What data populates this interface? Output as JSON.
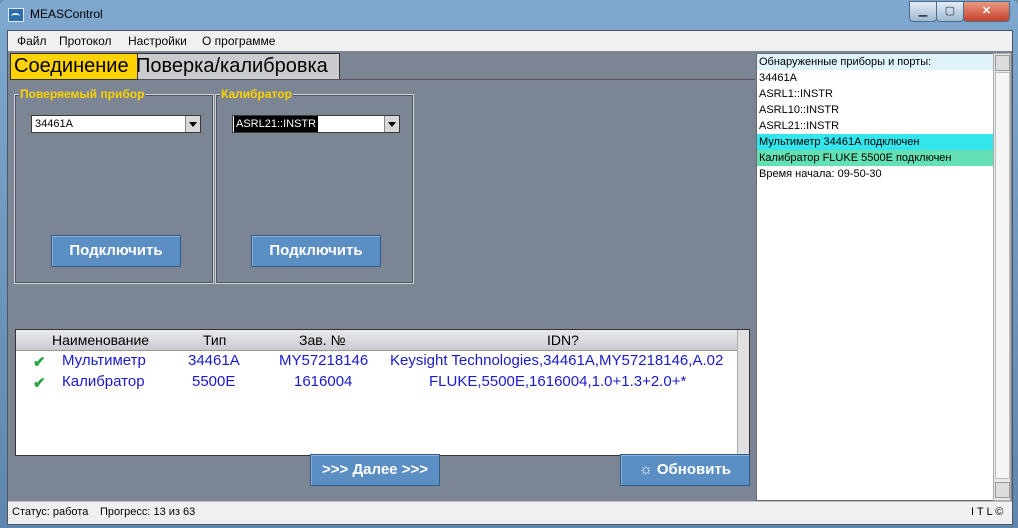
{
  "window": {
    "title": "MEASControl",
    "minimize": "▁",
    "maximize": "▢",
    "close": "✕"
  },
  "menu": [
    "Файл",
    "Протокол",
    "Настройки",
    "О программе"
  ],
  "tabs": {
    "active": "Соединение",
    "inactive": "Поверка/калибровка"
  },
  "device_group": {
    "title": "Поверяемый прибор",
    "selected": "34461A",
    "connect_label": "Подключить"
  },
  "calibrator_group": {
    "title": "Калибратор",
    "selected": "ASRL21::INSTR",
    "connect_label": "Подключить"
  },
  "table": {
    "headers": [
      "Наименование",
      "Тип",
      "Зав. №",
      "IDN?"
    ],
    "rows": [
      {
        "check": "✔",
        "name": "Мультиметр",
        "type": "34461A",
        "serial": "MY57218146",
        "idn": "Keysight Technologies,34461A,MY57218146,A.02"
      },
      {
        "check": "✔",
        "name": "Калибратор",
        "type": "5500E",
        "serial": "1616004",
        "idn": "FLUKE,5500E,1616004,1.0+1.3+2.0+*"
      }
    ]
  },
  "buttons": {
    "next": ">>> Далее >>>",
    "refresh": "☼ Обновить"
  },
  "log": {
    "lines": [
      {
        "text": "Обнаруженные приборы и порты:",
        "bg": "#dff3fa"
      },
      {
        "text": "34461A",
        "bg": "#ffffff"
      },
      {
        "text": "ASRL1::INSTR",
        "bg": "#ffffff"
      },
      {
        "text": "ASRL10::INSTR",
        "bg": "#ffffff"
      },
      {
        "text": "ASRL21::INSTR",
        "bg": "#ffffff"
      },
      {
        "text": "Мультиметр 34461A подключен",
        "bg": "#33e6ee"
      },
      {
        "text": "Калибратор FLUKE 5500E подключен",
        "bg": "#63e0b4"
      },
      {
        "text": "Время начала: 09-50-30",
        "bg": "#ffffff"
      }
    ]
  },
  "status": {
    "state": "Статус: работа",
    "progress": "Прогресс: 13 из 63",
    "brand": "I T L ©"
  },
  "colors": {
    "accent_yellow": "#ffd200",
    "button_blue": "#5b8fc4",
    "row_text_blue": "#1a1acd",
    "check_green": "#27a33b"
  }
}
